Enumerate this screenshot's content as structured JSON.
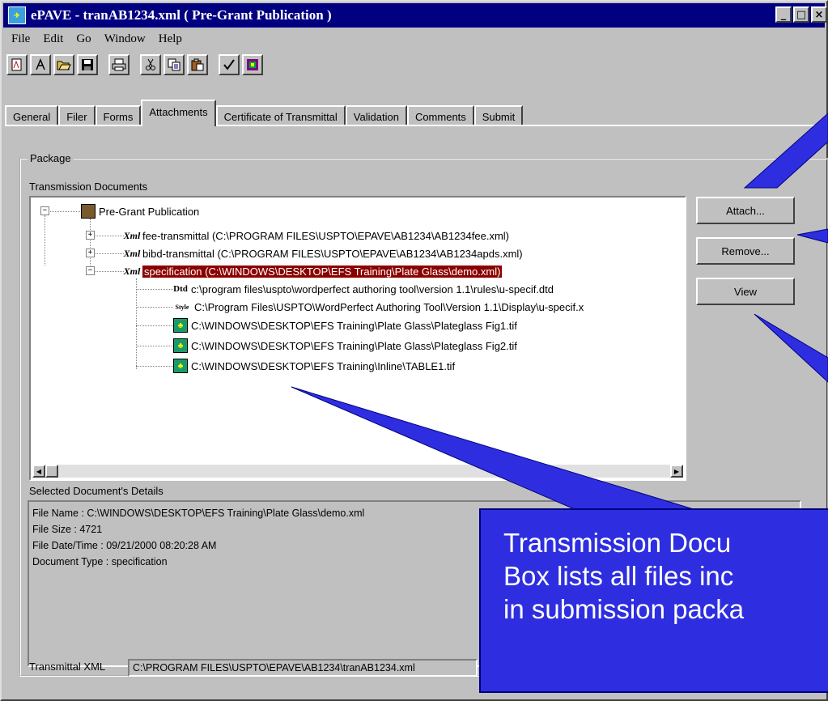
{
  "window": {
    "title": "ePAVE - tranAB1234.xml ( Pre-Grant Publication )",
    "minimize": "_",
    "maximize": "□",
    "close": "×"
  },
  "menu": [
    "File",
    "Edit",
    "Go",
    "Window",
    "Help"
  ],
  "toolbar_icons": [
    "new-doc-icon",
    "text-icon",
    "open-folder-icon",
    "save-icon",
    "print-icon",
    "cut-icon",
    "copy-icon",
    "paste-icon",
    "validate-check-icon",
    "submit-icon"
  ],
  "tabs": [
    "General",
    "Filer",
    "Forms",
    "Attachments",
    "Certificate of Transmittal",
    "Validation",
    "Comments",
    "Submit"
  ],
  "active_tab": "Attachments",
  "package": {
    "group_label": "Package",
    "tree_label": "Transmission Documents",
    "root": "Pre-Grant Publication",
    "items": [
      {
        "icon": "Xml",
        "text": "fee-transmittal (C:\\PROGRAM FILES\\USPTO\\EPAVE\\AB1234\\AB1234fee.xml)"
      },
      {
        "icon": "Xml",
        "text": "bibd-transmittal (C:\\PROGRAM FILES\\USPTO\\EPAVE\\AB1234\\AB1234apds.xml)"
      },
      {
        "icon": "Xml",
        "text": "specification (C:\\WINDOWS\\DESKTOP\\EFS Training\\Plate Glass\\demo.xml)",
        "selected": true
      }
    ],
    "children": [
      {
        "icon": "Dtd",
        "text": "c:\\program files\\uspto\\wordperfect authoring tool\\version 1.1\\rules\\u-specif.dtd"
      },
      {
        "icon": "Style",
        "text": "C:\\Program Files\\USPTO\\WordPerfect Authoring Tool\\Version 1.1\\Display\\u-specif.x"
      },
      {
        "icon": "tif",
        "text": "C:\\WINDOWS\\DESKTOP\\EFS Training\\Plate Glass\\Plateglass Fig1.tif"
      },
      {
        "icon": "tif",
        "text": "C:\\WINDOWS\\DESKTOP\\EFS Training\\Plate Glass\\Plateglass Fig2.tif"
      },
      {
        "icon": "tif",
        "text": "C:\\WINDOWS\\DESKTOP\\EFS Training\\Inline\\TABLE1.tif"
      }
    ]
  },
  "buttons": {
    "attach": "Attach...",
    "remove": "Remove...",
    "view": "View"
  },
  "details": {
    "label": "Selected Document's Details",
    "lines": [
      "File Name : C:\\WINDOWS\\DESKTOP\\EFS Training\\Plate Glass\\demo.xml",
      "File Size : 4721",
      "File Date/Time : 09/21/2000 08:20:28 AM",
      "Document Type : specification"
    ]
  },
  "transmittal": {
    "label": "Transmittal XML",
    "value": "C:\\PROGRAM FILES\\USPTO\\EPAVE\\AB1234\\tranAB1234.xml"
  },
  "callout": {
    "lines": [
      "Transmission Docu",
      "Box lists all files inc",
      "in submission packa"
    ]
  },
  "colors": {
    "callout": "#2e2ee0",
    "background": "#2a2ad0",
    "titlebar": "#000080",
    "selection": "#8b0000"
  }
}
